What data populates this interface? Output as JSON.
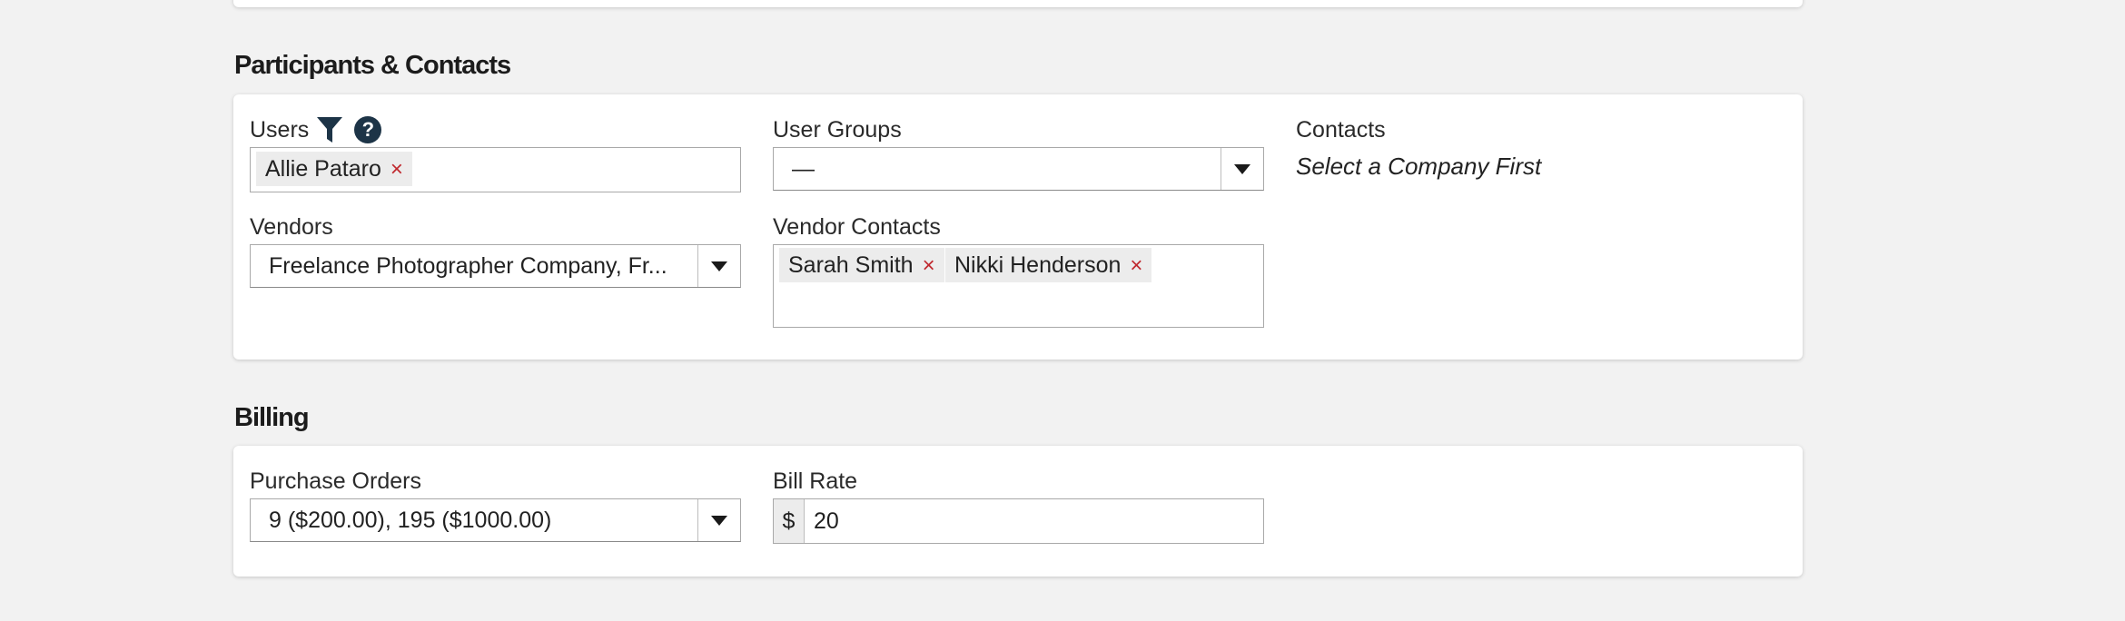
{
  "participants": {
    "section_title": "Participants & Contacts",
    "users": {
      "label": "Users",
      "filter_icon": "filter-icon",
      "help_icon": "help-icon",
      "help_glyph": "?",
      "tags": [
        {
          "label": "Allie Pataro",
          "remove": "×"
        }
      ]
    },
    "user_groups": {
      "label": "User Groups",
      "value": "—"
    },
    "contacts": {
      "label": "Contacts",
      "hint": "Select a Company First"
    },
    "vendors": {
      "label": "Vendors",
      "value": "Freelance Photographer Company, Fr..."
    },
    "vendor_contacts": {
      "label": "Vendor Contacts",
      "tags": [
        {
          "label": "Sarah Smith",
          "remove": "×"
        },
        {
          "label": "Nikki Henderson",
          "remove": "×"
        }
      ]
    }
  },
  "billing": {
    "section_title": "Billing",
    "purchase_orders": {
      "label": "Purchase Orders",
      "value": "9 ($200.00), 195 ($1000.00)"
    },
    "bill_rate": {
      "label": "Bill Rate",
      "prefix": "$",
      "value": "20"
    }
  },
  "colors": {
    "background": "#f2f2f2",
    "card": "#ffffff",
    "remove_x": "#c0272d",
    "icon_navy": "#1d3447"
  }
}
